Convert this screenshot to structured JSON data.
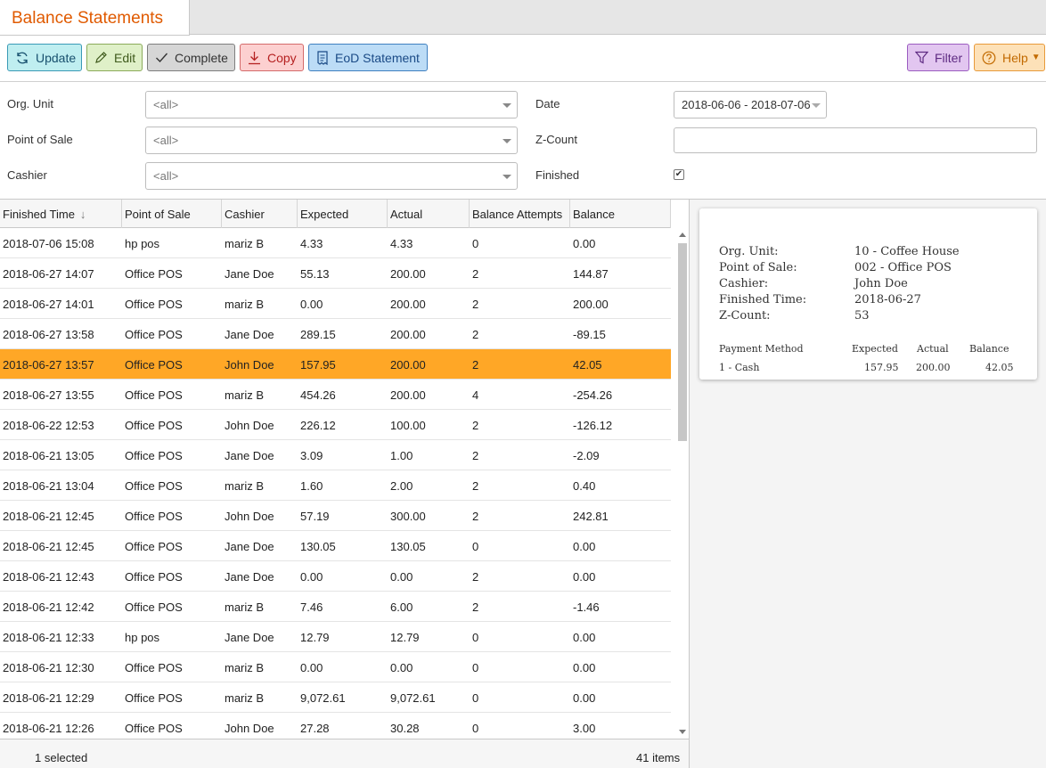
{
  "tab": {
    "title": "Balance Statements"
  },
  "toolbar": {
    "update": "Update",
    "edit": "Edit",
    "complete": "Complete",
    "copy": "Copy",
    "eod": "EoD Statement",
    "filter": "Filter",
    "help": "Help"
  },
  "filters": {
    "org_unit_label": "Org. Unit",
    "org_unit_value": "<all>",
    "pos_label": "Point of Sale",
    "pos_value": "<all>",
    "cashier_label": "Cashier",
    "cashier_value": "<all>",
    "date_label": "Date",
    "date_value": "2018-06-06 - 2018-07-06",
    "zcount_label": "Z-Count",
    "zcount_value": "",
    "finished_label": "Finished",
    "finished_checked": true
  },
  "grid": {
    "columns": [
      "Finished Time",
      "Point of Sale",
      "Cashier",
      "Expected",
      "Actual",
      "Balance Attempts",
      "Balance"
    ],
    "selected_index": 4,
    "rows": [
      [
        "2018-07-06 15:08",
        "hp pos",
        "mariz B",
        "4.33",
        "4.33",
        "0",
        "0.00"
      ],
      [
        "2018-06-27 14:07",
        "Office POS",
        "Jane Doe",
        "55.13",
        "200.00",
        "2",
        "144.87"
      ],
      [
        "2018-06-27 14:01",
        "Office POS",
        "mariz B",
        "0.00",
        "200.00",
        "2",
        "200.00"
      ],
      [
        "2018-06-27 13:58",
        "Office POS",
        "Jane Doe",
        "289.15",
        "200.00",
        "2",
        "-89.15"
      ],
      [
        "2018-06-27 13:57",
        "Office POS",
        "John Doe",
        "157.95",
        "200.00",
        "2",
        "42.05"
      ],
      [
        "2018-06-27 13:55",
        "Office POS",
        "mariz B",
        "454.26",
        "200.00",
        "4",
        "-254.26"
      ],
      [
        "2018-06-22 12:53",
        "Office POS",
        "John Doe",
        "226.12",
        "100.00",
        "2",
        "-126.12"
      ],
      [
        "2018-06-21 13:05",
        "Office POS",
        "Jane Doe",
        "3.09",
        "1.00",
        "2",
        "-2.09"
      ],
      [
        "2018-06-21 13:04",
        "Office POS",
        "mariz B",
        "1.60",
        "2.00",
        "2",
        "0.40"
      ],
      [
        "2018-06-21 12:45",
        "Office POS",
        "John Doe",
        "57.19",
        "300.00",
        "2",
        "242.81"
      ],
      [
        "2018-06-21 12:45",
        "Office POS",
        "Jane Doe",
        "130.05",
        "130.05",
        "0",
        "0.00"
      ],
      [
        "2018-06-21 12:43",
        "Office POS",
        "Jane Doe",
        "0.00",
        "0.00",
        "2",
        "0.00"
      ],
      [
        "2018-06-21 12:42",
        "Office POS",
        "mariz B",
        "7.46",
        "6.00",
        "2",
        "-1.46"
      ],
      [
        "2018-06-21 12:33",
        "hp pos",
        "Jane Doe",
        "12.79",
        "12.79",
        "0",
        "0.00"
      ],
      [
        "2018-06-21 12:30",
        "Office POS",
        "mariz B",
        "0.00",
        "0.00",
        "0",
        "0.00"
      ],
      [
        "2018-06-21 12:29",
        "Office POS",
        "mariz B",
        "9,072.61",
        "9,072.61",
        "0",
        "0.00"
      ],
      [
        "2018-06-21 12:26",
        "Office POS",
        "John Doe",
        "27.28",
        "30.28",
        "0",
        "3.00"
      ]
    ],
    "footer_selected": "1 selected",
    "footer_count": "41 items"
  },
  "preview": {
    "org_unit_label": "Org. Unit:",
    "org_unit_value": "10 - Coffee House",
    "pos_label": "Point of Sale:",
    "pos_value": "002 - Office POS",
    "cashier_label": "Cashier:",
    "cashier_value": "John Doe",
    "finished_label": "Finished Time:",
    "finished_value": "2018-06-27",
    "zcount_label": "Z-Count:",
    "zcount_value": "53",
    "table_headers": [
      "Payment Method",
      "Expected",
      "Actual",
      "Balance"
    ],
    "table_row": [
      "1 - Cash",
      "157.95",
      "200.00",
      "42.05"
    ]
  },
  "colors": {
    "accent": "#e05a00",
    "selected_row": "#ffa726"
  }
}
